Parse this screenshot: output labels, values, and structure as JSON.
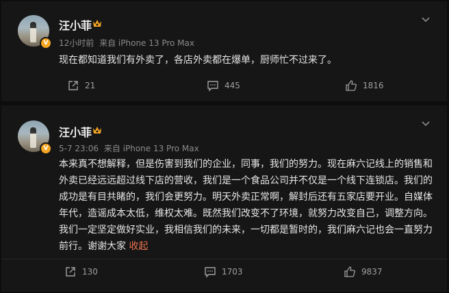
{
  "posts": [
    {
      "author": "汪小菲",
      "time": "12小时前",
      "source": "来自 iPhone 13 Pro Max",
      "content": "现在都知道我们有外卖了，各店外卖都在爆单，厨师忙不过来了。",
      "repost_count": "21",
      "comment_count": "445",
      "like_count": "1816"
    },
    {
      "author": "汪小菲",
      "time": "5-7 23:06",
      "source": "来自 iPhone 13 Pro Max",
      "content": "本来真不想解释，但是伤害到我们的企业，同事，我们的努力。现在麻六记线上的销售和外卖已经远远超过线下店的营收，我们是一个食品公司并不仅是一个线下连锁店。我们的成功是有目共睹的，我们会更努力。明天外卖正常啊，解封后还有五家店要开业。自媒体年代，造谣成本太低，维权太难。既然我们改变不了环境，就努力改变自己，调整方向。我们一定坚定做好实业，我相信我们的未来，一切都是暂时的，我们麻六记也会一直努力前行。谢谢大家",
      "collapse_label": "收起",
      "repost_count": "130",
      "comment_count": "1703",
      "like_count": "9837"
    }
  ],
  "colors": {
    "background": "#0d0d0d",
    "card": "#161616",
    "verified_badge": "#f5a623",
    "crown": "#f5a623",
    "link_accent": "#eb7350"
  },
  "icons": {
    "verified": "verified-v-badge",
    "member": "crown-icon",
    "menu": "chevron-down-icon",
    "repost": "share-icon",
    "comment": "comment-icon",
    "like": "thumbs-up-icon"
  }
}
